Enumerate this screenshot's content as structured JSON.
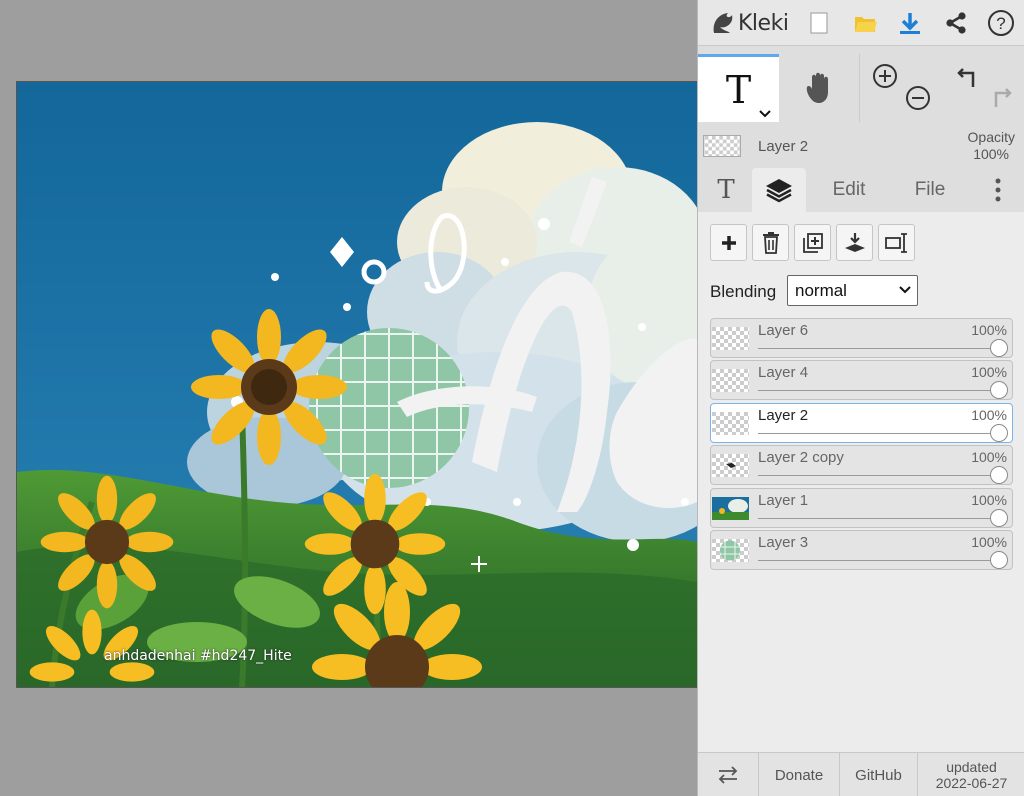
{
  "app": {
    "name": "Kleki"
  },
  "topbar": {
    "icons": [
      "new-image-icon",
      "open-folder-icon",
      "download-icon",
      "share-icon",
      "help-icon"
    ]
  },
  "tools": {
    "active_tool": "text-tool",
    "items": [
      "text-tool-icon",
      "hand-tool-icon",
      "zoom-in-icon",
      "zoom-out-icon",
      "undo-icon",
      "redo-icon"
    ]
  },
  "current_layer": {
    "name": "Layer 2",
    "opacity_label": "Opacity",
    "opacity_value": "100%"
  },
  "tabs": [
    {
      "label": "T",
      "icon": "text-tab-icon"
    },
    {
      "label": "",
      "icon": "layers-icon",
      "active": true
    },
    {
      "label": "Edit"
    },
    {
      "label": "File"
    },
    {
      "label": "",
      "icon": "more-vertical-icon"
    }
  ],
  "layer_actions": [
    "add-layer-icon",
    "delete-layer-icon",
    "duplicate-layer-icon",
    "merge-down-icon",
    "rename-layer-icon"
  ],
  "blending": {
    "label": "Blending",
    "value": "normal"
  },
  "layers": [
    {
      "name": "Layer 6",
      "opacity": "100%",
      "selected": false,
      "thumb": "empty"
    },
    {
      "name": "Layer 4",
      "opacity": "100%",
      "selected": false,
      "thumb": "empty"
    },
    {
      "name": "Layer 2",
      "opacity": "100%",
      "selected": true,
      "thumb": "empty"
    },
    {
      "name": "Layer 2 copy",
      "opacity": "100%",
      "selected": false,
      "thumb": "small-mark"
    },
    {
      "name": "Layer 1",
      "opacity": "100%",
      "selected": false,
      "thumb": "landscape"
    },
    {
      "name": "Layer 3",
      "opacity": "100%",
      "selected": false,
      "thumb": "green-circle"
    }
  ],
  "canvas": {
    "watermark": "anhdadenhai #hd247_Hite"
  },
  "bottombar": {
    "swap_icon": "swap-icon",
    "donate": "Donate",
    "github": "GitHub",
    "updated_label": "updated",
    "updated_date": "2022-06-27"
  },
  "colors": {
    "accent": "#5fa8ef",
    "panel_bg": "#dedede",
    "workspace_bg": "#9e9e9e",
    "sky": "#1a6f9f"
  }
}
